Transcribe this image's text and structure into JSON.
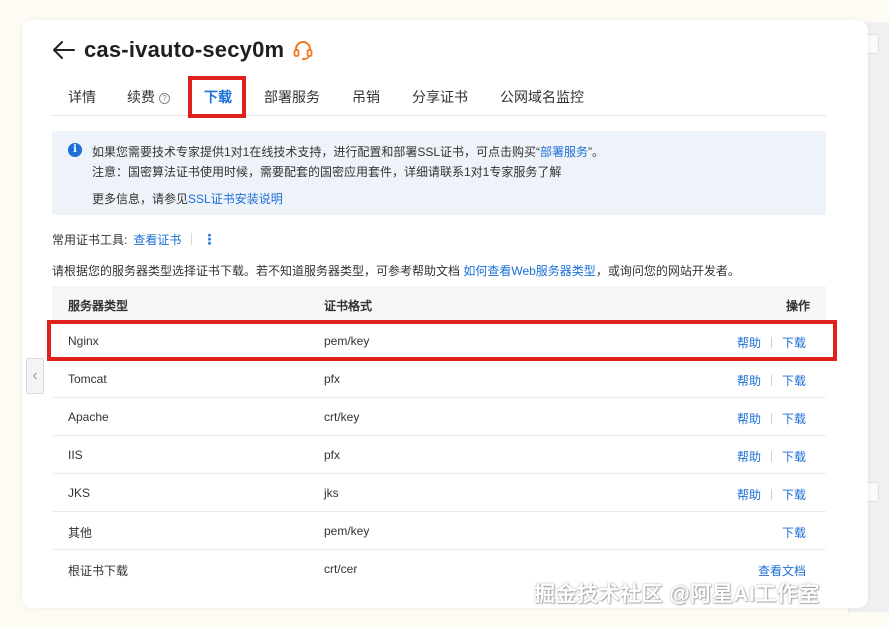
{
  "header": {
    "title": "cas-ivauto-secy0m",
    "back_icon": "arrow-left-icon",
    "support_icon": "headset-icon",
    "accent_color": "#ee7b22"
  },
  "tabs": [
    {
      "label": "详情"
    },
    {
      "label": "续费",
      "help_icon": "?"
    },
    {
      "label": "下载",
      "active": true
    },
    {
      "label": "部署服务"
    },
    {
      "label": "吊销"
    },
    {
      "label": "分享证书"
    },
    {
      "label": "公网域名监控"
    }
  ],
  "notice": {
    "icon_glyph": "i",
    "line1_pre": "如果您需要技术专家提供1对1在线技术支持，进行配置和部署SSL证书，可点击购买“",
    "line1_link": "部署服务",
    "line1_post": "”。",
    "line2": "注意：国密算法证书使用时候，需要配套的国密应用套件，详细请联系1对1专家服务了解",
    "line3_pre": "更多信息，请参见",
    "line3_link": "SSL证书安装说明"
  },
  "tools": {
    "label": "常用证书工具:",
    "link": "查看证书",
    "more_glyph": "⋮"
  },
  "hint": {
    "pre": "请根据您的服务器类型选择证书下载。若不知道服务器类型，可参考帮助文档 ",
    "link": "如何查看Web服务器类型",
    "post": "，或询问您的网站开发者。"
  },
  "table": {
    "headers": {
      "server": "服务器类型",
      "format": "证书格式",
      "actions": "操作"
    },
    "rows": [
      {
        "server": "Nginx",
        "format": "pem/key",
        "help": "帮助",
        "action": "下载"
      },
      {
        "server": "Tomcat",
        "format": "pfx",
        "help": "帮助",
        "action": "下载"
      },
      {
        "server": "Apache",
        "format": "crt/key",
        "help": "帮助",
        "action": "下载"
      },
      {
        "server": "IIS",
        "format": "pfx",
        "help": "帮助",
        "action": "下载"
      },
      {
        "server": "JKS",
        "format": "jks",
        "help": "帮助",
        "action": "下载"
      },
      {
        "server": "其他",
        "format": "pem/key",
        "help": "",
        "action": "下载"
      },
      {
        "server": "根证书下载",
        "format": "crt/cer",
        "help": "",
        "action": "查看文档"
      }
    ]
  },
  "side": {
    "collapse_glyph": "‹"
  },
  "watermark": "掘金技术社区 @阿星AI工作室",
  "colors": {
    "link": "#1b6fd6",
    "highlight": "#e0201b",
    "notice_bg": "#eef3fa"
  }
}
